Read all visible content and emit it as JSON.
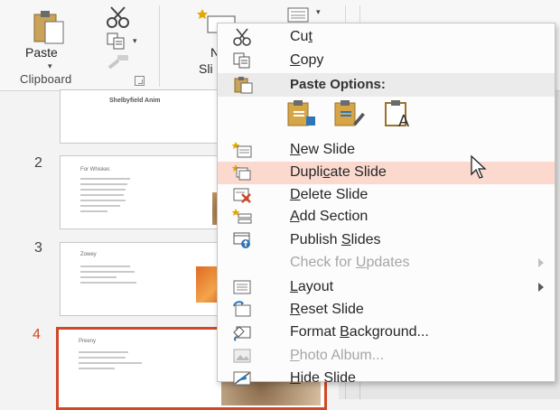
{
  "ribbon": {
    "paste_label": "Paste",
    "new_slide_label_lines": [
      "N",
      "Sli"
    ],
    "clipboard_group_label": "Clipboard"
  },
  "thumbnails": [
    {
      "number": "",
      "title": "Shelbyfield Anim",
      "has_image": false
    },
    {
      "number": "2",
      "title": "For Whisker.",
      "has_image": true
    },
    {
      "number": "3",
      "title": "Zowey",
      "has_image": true
    },
    {
      "number": "4",
      "title": "Preeny",
      "has_image": true,
      "selected": true
    }
  ],
  "context_menu": {
    "items": [
      {
        "pre": "Cu",
        "ul": "t",
        "post": "",
        "icon": "scissors-icon",
        "enabled": true
      },
      {
        "pre": "",
        "ul": "C",
        "post": "opy",
        "icon": "copy-icon",
        "enabled": true
      },
      {
        "pre": "",
        "ul": "N",
        "post": "ew Slide",
        "icon": "new-slide-icon",
        "enabled": true
      },
      {
        "pre": "Dupli",
        "ul": "c",
        "post": "ate Slide",
        "icon": "duplicate-slide-icon",
        "enabled": true,
        "hover": true
      },
      {
        "pre": "",
        "ul": "D",
        "post": "elete Slide",
        "icon": "delete-slide-icon",
        "enabled": true
      },
      {
        "pre": "",
        "ul": "A",
        "post": "dd Section",
        "icon": "add-section-icon",
        "enabled": true
      },
      {
        "pre": "Publish ",
        "ul": "S",
        "post": "lides",
        "icon": "publish-slides-icon",
        "enabled": true
      },
      {
        "pre": "Check for ",
        "ul": "U",
        "post": "pdates",
        "icon": "",
        "enabled": false,
        "submenu": true
      },
      {
        "pre": "",
        "ul": "L",
        "post": "ayout",
        "icon": "layout-icon",
        "enabled": true,
        "submenu": true
      },
      {
        "pre": "",
        "ul": "R",
        "post": "eset Slide",
        "icon": "reset-slide-icon",
        "enabled": true
      },
      {
        "pre": "Format ",
        "ul": "B",
        "post": "ackground...",
        "icon": "format-background-icon",
        "enabled": true
      },
      {
        "pre": "",
        "ul": "P",
        "post": "hoto Album...",
        "icon": "photo-album-icon",
        "enabled": false
      },
      {
        "pre": "",
        "ul": "H",
        "post": "ide Slide",
        "icon": "hide-slide-icon",
        "enabled": true
      }
    ],
    "paste_options_header": "Paste Options:",
    "paste_option_icons": [
      "paste-use-destination-theme-icon",
      "paste-keep-source-formatting-icon",
      "paste-keep-text-only-icon"
    ]
  },
  "colors": {
    "accent": "#d24726",
    "hover": "#fbd9cf"
  }
}
